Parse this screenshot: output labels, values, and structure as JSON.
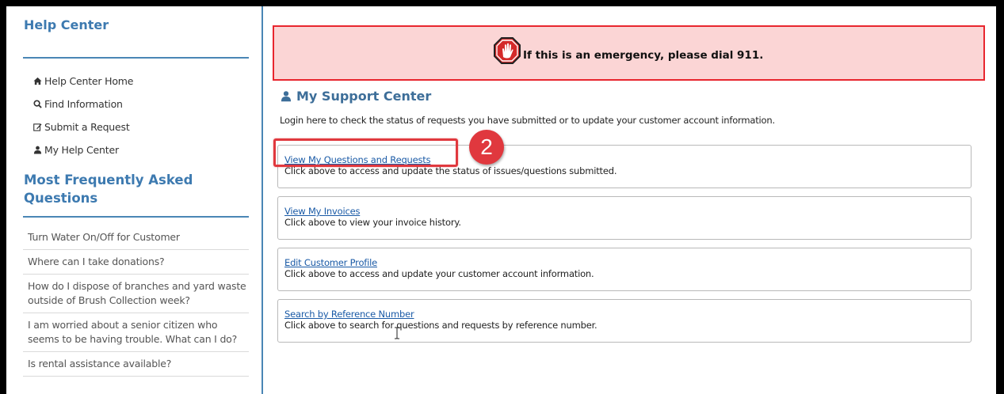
{
  "sidebar": {
    "title": "Help Center",
    "nav": [
      {
        "label": "Help Center Home",
        "icon": "home-icon"
      },
      {
        "label": "Find Information",
        "icon": "search-icon"
      },
      {
        "label": "Submit a Request",
        "icon": "edit-icon"
      },
      {
        "label": "My Help Center",
        "icon": "user-icon"
      }
    ],
    "faq_title": "Most Frequently Asked Questions",
    "faq": [
      "Turn Water On/Off for Customer",
      "Where can I take donations?",
      "How do I dispose of branches and yard waste outside of Brush Collection week?",
      "I am worried about a senior citizen who seems to be having trouble. What can I do?",
      "Is rental assistance available?"
    ]
  },
  "alert": {
    "text": "If this is an emergency, please dial 911.",
    "icon": "stop-hand-icon",
    "background": "#fbd5d5",
    "border": "#e8262e"
  },
  "support": {
    "title": "My Support Center",
    "title_icon": "user-icon",
    "description": "Login here to check the status of requests you have submitted or to update your customer account information.",
    "cards": [
      {
        "link": "View My Questions and Requests",
        "desc": "Click above to access and update the status of issues/questions submitted."
      },
      {
        "link": "View My Invoices",
        "desc": "Click above to view your invoice history."
      },
      {
        "link": "Edit Customer Profile",
        "desc": "Click above to access and update your customer account information."
      },
      {
        "link": "Search by Reference Number",
        "desc": "Click above to search for questions and requests by reference number."
      }
    ]
  },
  "annotation": {
    "step_number": "2",
    "color": "#e0383e"
  },
  "colors": {
    "accent": "#3d7ab0",
    "link": "#1a5aa6"
  }
}
